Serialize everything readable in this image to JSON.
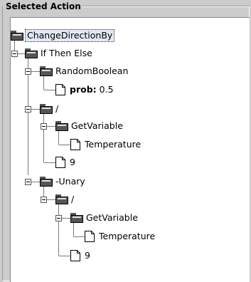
{
  "panel": {
    "title": "Selected Action"
  },
  "tree": [
    {
      "label": "ChangeDirectionBy",
      "selected": true
    },
    {
      "label": "If Then Else"
    },
    {
      "label": "RandomBoolean"
    },
    {
      "key": "prob:",
      "value": "0.5"
    },
    {
      "label": "/"
    },
    {
      "label": "GetVariable"
    },
    {
      "label": "Temperature"
    },
    {
      "label": "9"
    },
    {
      "label": "-Unary"
    },
    {
      "label": "/"
    },
    {
      "label": "GetVariable"
    },
    {
      "label": "Temperature"
    },
    {
      "label": "9"
    }
  ]
}
